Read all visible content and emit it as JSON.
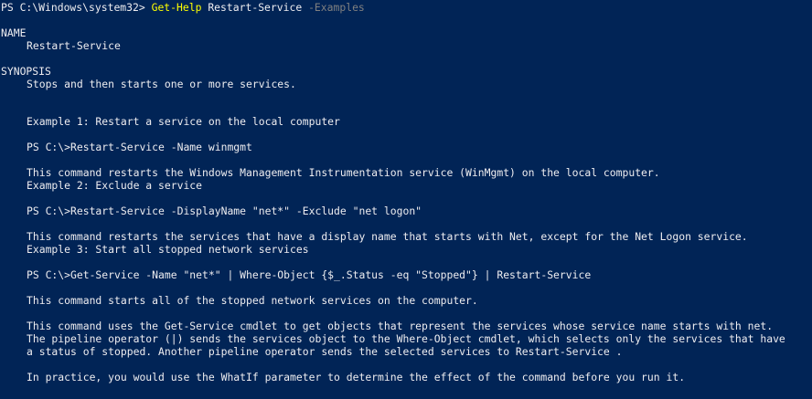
{
  "console": {
    "prompt": "PS C:\\Windows\\system32> ",
    "command": "Get-Help",
    "argument": " Restart-Service ",
    "parameter": "-Examples",
    "theme": {
      "background": "#012456",
      "foreground": "#eeedf0",
      "command_color": "#ffff00",
      "parameter_color": "#808080"
    }
  },
  "help": {
    "name_heading": "NAME",
    "name_value": "Restart-Service",
    "synopsis_heading": "SYNOPSIS",
    "synopsis_value": "Stops and then starts one or more services.",
    "examples": [
      {
        "title": "Example 1: Restart a service on the local computer",
        "code": "PS C:\\>Restart-Service -Name winmgmt",
        "description": [
          "This command restarts the Windows Management Instrumentation service (WinMgmt) on the local computer."
        ]
      },
      {
        "title": "Example 2: Exclude a service",
        "code": "PS C:\\>Restart-Service -DisplayName \"net*\" -Exclude \"net logon\"",
        "description": [
          "This command restarts the services that have a display name that starts with Net, except for the Net Logon service."
        ]
      },
      {
        "title": "Example 3: Start all stopped network services",
        "code": "PS C:\\>Get-Service -Name \"net*\" | Where-Object {$_.Status -eq \"Stopped\"} | Restart-Service",
        "description": [
          "This command starts all of the stopped network services on the computer.",
          "This command uses the Get-Service cmdlet to get objects that represent the services whose service name starts with net.",
          "The pipeline operator (|) sends the services object to the Where-Object cmdlet, which selects only the services that have",
          "a status of stopped. Another pipeline operator sends the selected services to Restart-Service .",
          "In practice, you would use the WhatIf parameter to determine the effect of the command before you run it."
        ]
      }
    ]
  }
}
